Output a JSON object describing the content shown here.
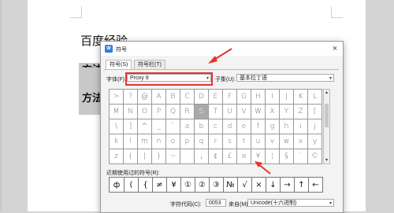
{
  "document": {
    "title": "百度经验",
    "method1": "方法",
    "method2": "方法"
  },
  "dialog": {
    "title": "符号",
    "app_icon": "W",
    "close_glyph": "×",
    "tabs": [
      {
        "label": "符号(S)"
      },
      {
        "label": "符号栏(T)"
      }
    ],
    "font_label": "字体(F):",
    "font_value": "Proxy 8",
    "subset_label": "子集(U):",
    "subset_value": "基本拉丁语",
    "dropdown_glyph": "▾",
    "grid": [
      [
        ">",
        "?",
        "@",
        "A",
        "B",
        "C",
        "D",
        "E",
        "F",
        "G",
        "H",
        "I",
        "J",
        "K",
        "L"
      ],
      [
        "M",
        "N",
        "O",
        "P",
        "Q",
        "R",
        "S",
        "T",
        "U",
        "V",
        "W",
        "X",
        "Y",
        "Z",
        "["
      ],
      [
        "\\",
        "]",
        "^",
        "_",
        "`",
        "a",
        "b",
        "c",
        "d",
        "e",
        "f",
        "g",
        "h",
        "i",
        "j"
      ],
      [
        "k",
        "l",
        "m",
        "n",
        "o",
        "p",
        "q",
        "r",
        "s",
        "t",
        "u",
        "v",
        "w",
        "x",
        "y"
      ],
      [
        "z",
        "{",
        "|",
        "}",
        "~",
        "",
        "¡",
        "¢",
        "£",
        "¤",
        "¥",
        "¦",
        "§",
        "¨",
        "©"
      ]
    ],
    "selected_symbol": "S",
    "recent_label": "近期使用过的符号(R):",
    "recent": [
      "ф",
      "(",
      "{",
      "≠",
      "¥",
      "①",
      "②",
      "③",
      "№",
      "√",
      "×",
      "↓",
      "→",
      "↑",
      "←"
    ],
    "charcode_label": "字符代码(C):",
    "charcode_value": "0053",
    "from_label": "来自(M)",
    "from_value": "Unicode(十六进制)",
    "scroll_up": "▴",
    "scroll_down": "▾",
    "accent_color": "#e8332a"
  }
}
